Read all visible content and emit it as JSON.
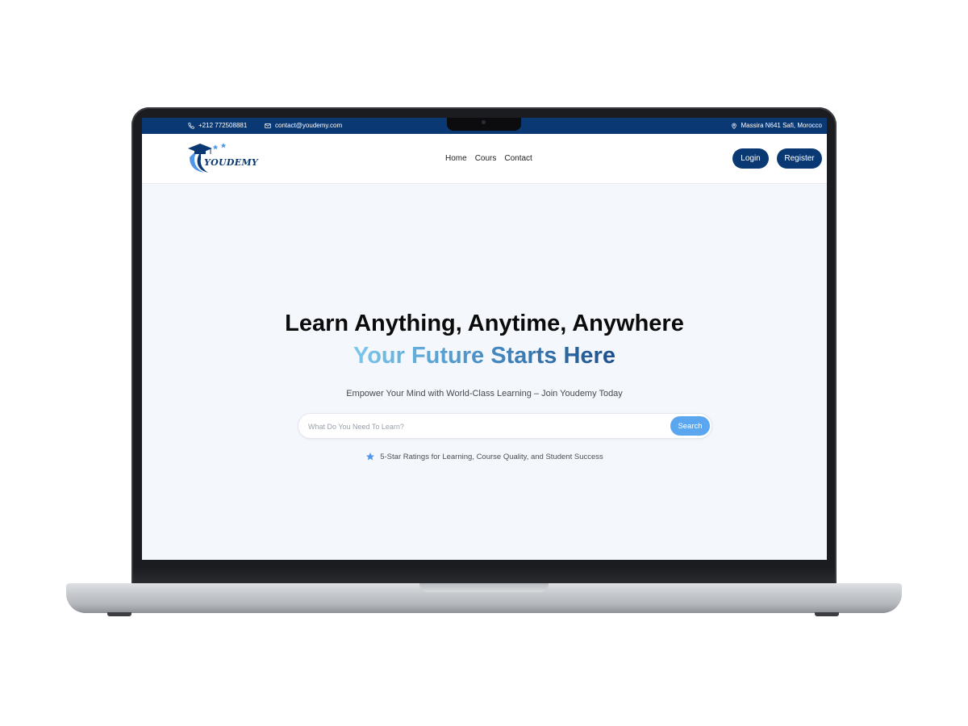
{
  "topbar": {
    "phone": "+212 772508881",
    "email": "contact@youdemy.com",
    "address": "Massira N641 Safi, Morocco"
  },
  "brand": {
    "name": "YOUDEMY"
  },
  "nav": {
    "links": [
      "Home",
      "Cours",
      "Contact"
    ],
    "login_label": "Login",
    "register_label": "Register"
  },
  "hero": {
    "title": "Learn Anything, Anytime, Anywhere",
    "subtitle": "Your Future Starts Here",
    "tagline": "Empower Your Mind with World-Class Learning – Join Youdemy Today",
    "search_placeholder": "What Do You Need To Learn?",
    "search_label": "Search",
    "rating_text": "5-Star Ratings for Learning, Course Quality, and Student Success"
  },
  "colors": {
    "navy": "#0a3873",
    "search_button": "#5aa7ef",
    "gradient_start": "#7cc7eb",
    "gradient_end": "#1d4f8a",
    "star": "#4f95e8"
  },
  "icons": [
    "phone-icon",
    "mail-icon",
    "location-pin-icon",
    "graduation-cap-icon",
    "star-icon"
  ]
}
